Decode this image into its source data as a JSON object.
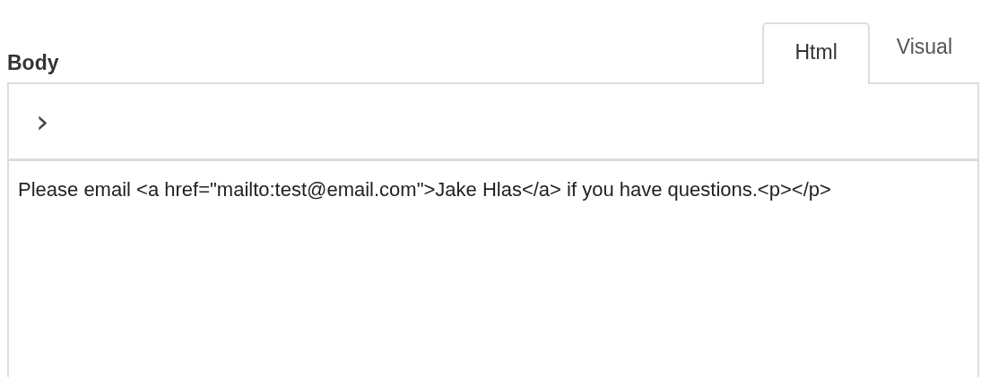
{
  "field_label": "Body",
  "tabs": [
    {
      "label": "Html",
      "selected": true
    },
    {
      "label": "Visual",
      "selected": false
    }
  ],
  "toolbar": {
    "expand_icon": "›"
  },
  "editor": {
    "value": "Please email <a href=\"mailto:test@email.com\">Jake Hlas</a> if you have questions.<p></p>"
  }
}
